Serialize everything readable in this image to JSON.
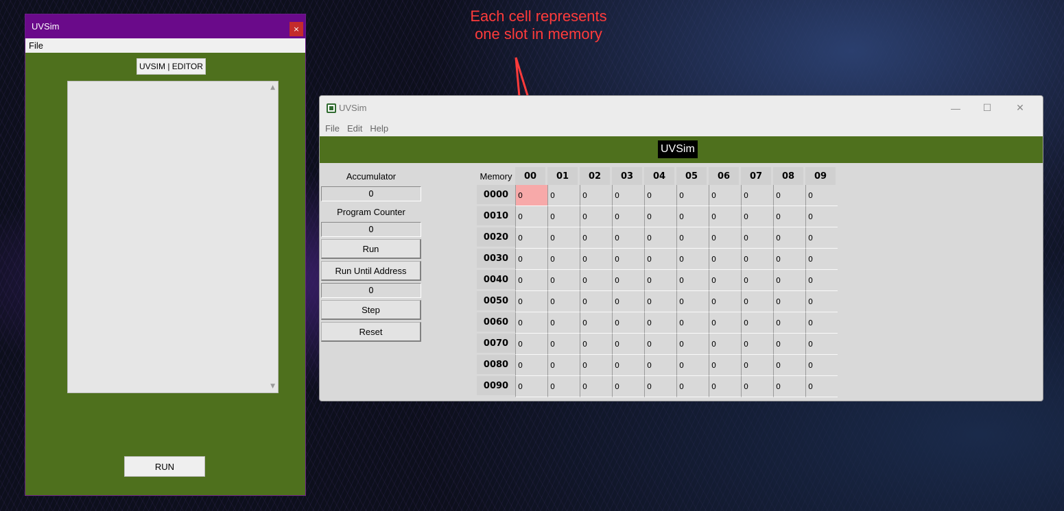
{
  "editor": {
    "title": "UVSim",
    "close_glyph": "×",
    "menu": [
      "File"
    ],
    "header_label": "UVSIM | EDITOR",
    "run_label": "RUN"
  },
  "annotation": {
    "line1": "Each cell represents",
    "line2": "one slot in memory",
    "color": "#ff3b3b"
  },
  "main": {
    "title": "UVSim",
    "icon": "chip-icon",
    "menu": [
      "File",
      "Edit",
      "Help"
    ],
    "banner": "UVSim",
    "controls": {
      "minimize": "—",
      "maximize": "☐",
      "close": "✕"
    },
    "panel": {
      "accumulator_label": "Accumulator",
      "accumulator_value": "0",
      "pc_label": "Program Counter",
      "pc_value": "0",
      "run_label": "Run",
      "run_until_label": "Run Until Address",
      "run_until_value": "0",
      "step_label": "Step",
      "reset_label": "Reset"
    },
    "memory": {
      "label": "Memory",
      "columns": [
        "00",
        "01",
        "02",
        "03",
        "04",
        "05",
        "06",
        "07",
        "08",
        "09"
      ],
      "rows": [
        "0000",
        "0010",
        "0020",
        "0030",
        "0040",
        "0050",
        "0060",
        "0070",
        "0080",
        "0090"
      ],
      "cell_value": "0",
      "highlighted_cell": "0000-00"
    }
  },
  "colors": {
    "green": "#4e701d",
    "purple_titlebar": "#6a0a8a",
    "highlight": "#f7a9a9"
  }
}
